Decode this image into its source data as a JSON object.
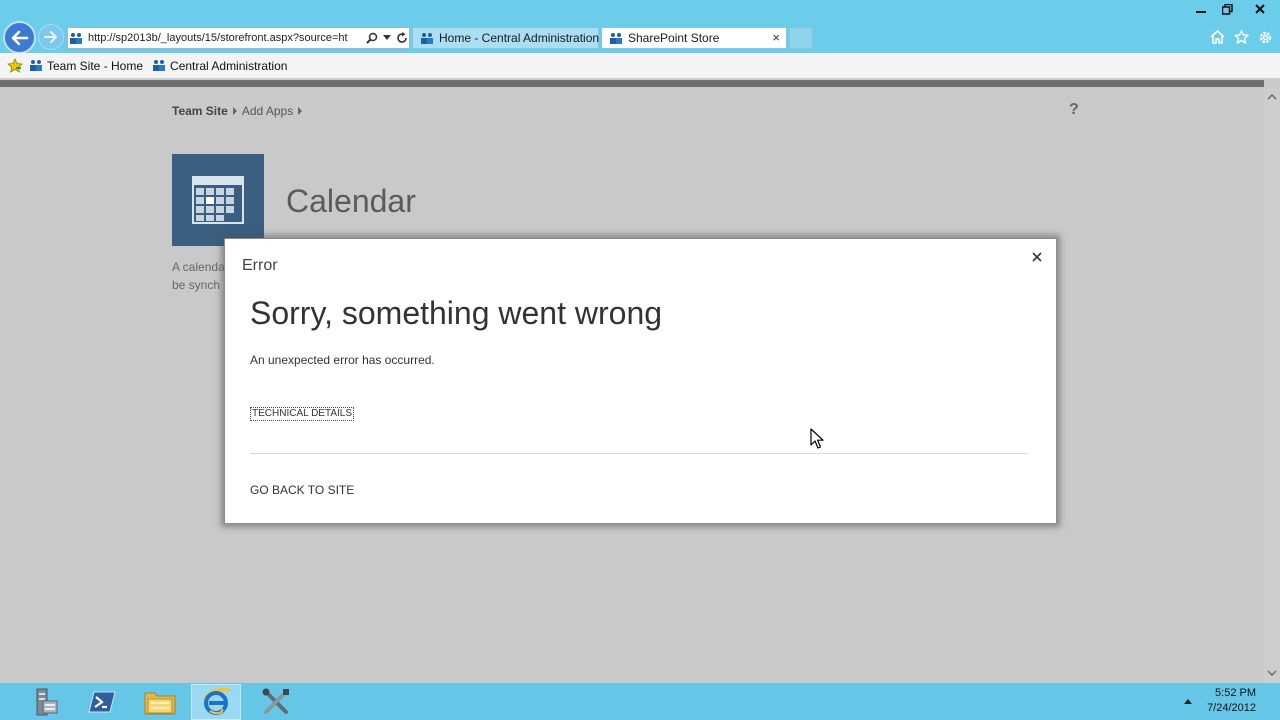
{
  "browser": {
    "address_url": "http://sp2013b/_layouts/15/storefront.aspx?source=ht",
    "tabs": [
      {
        "label": "Home - Central Administration",
        "active": false
      },
      {
        "label": "SharePoint Store",
        "active": true
      }
    ],
    "tab_close": "×",
    "favorites": [
      {
        "label": "Team Site - Home"
      },
      {
        "label": "Central Administration"
      }
    ]
  },
  "page": {
    "breadcrumb": [
      "Team Site",
      "Add Apps"
    ],
    "help_icon_label": "?",
    "app_title": "Calendar",
    "app_description_line1": "A calenda",
    "app_description_line2": "be synch"
  },
  "dialog": {
    "title": "Error",
    "heading": "Sorry, something went wrong",
    "message": "An unexpected error has occurred.",
    "technical_details": "TECHNICAL DETAILS",
    "go_back": "GO BACK TO SITE"
  },
  "taskbar": {
    "time": "5:52 PM",
    "date": "7/24/2012"
  },
  "colors": {
    "chrome": "#6ccdeb",
    "taskbar": "#66c6e8",
    "app_tile": "#3a5f80",
    "overlay_background": "#c9c9c9"
  }
}
